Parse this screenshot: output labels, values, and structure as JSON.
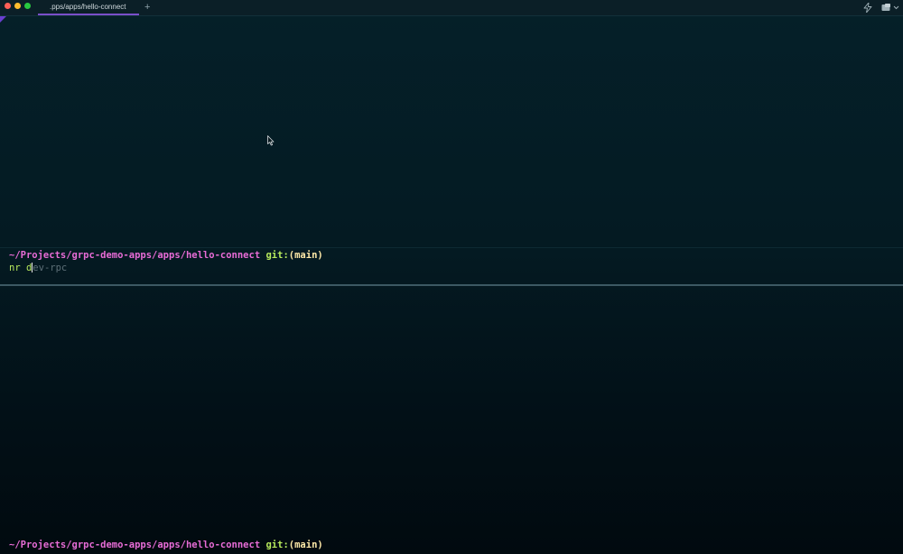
{
  "window": {
    "tab_title": ".pps/apps/hello-connect",
    "new_tab_glyph": "+"
  },
  "icons": {
    "traffic_lights": [
      "close-window",
      "minimize-window",
      "maximize-window"
    ],
    "toolbar_right": [
      "bolt-icon",
      "window-menu-icon",
      "chevron-down-icon"
    ]
  },
  "colors": {
    "path": "#e86cd6",
    "git_label": "#b7ea5d",
    "branch": "#ffe9a8",
    "accent": "#7a4fc9",
    "suggestion": "#5e7078"
  },
  "top_pane": {
    "prompt": {
      "path": "~/Projects/grpc-demo-apps/apps/hello-connect",
      "git_label": "git:",
      "branch": "(main)"
    },
    "command": {
      "typed": "nr d",
      "suggestion": "ev-rpc"
    }
  },
  "bottom_pane": {
    "prompt": {
      "path": "~/Projects/grpc-demo-apps/apps/hello-connect",
      "git_label": "git:",
      "branch": "(main)"
    }
  }
}
